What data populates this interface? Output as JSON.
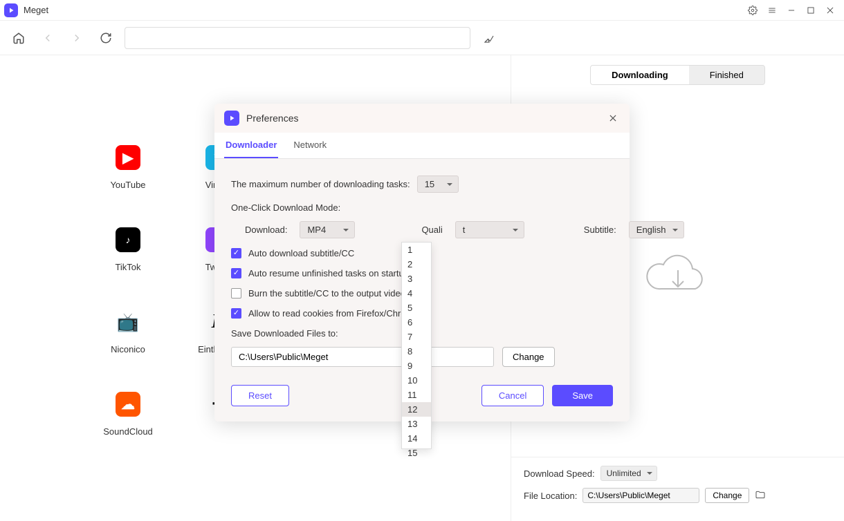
{
  "app": {
    "name": "Meget"
  },
  "toolbar": {
    "url_value": ""
  },
  "sites": [
    {
      "name": "YouTube"
    },
    {
      "name": "Vimeo"
    },
    {
      "name": "TikTok"
    },
    {
      "name": "Twitch"
    },
    {
      "name": "Niconico"
    },
    {
      "name": "Einthusan"
    },
    {
      "name": "SoundCloud"
    },
    {
      "name": ""
    }
  ],
  "right_panel": {
    "tabs": {
      "downloading": "Downloading",
      "finished": "Finished"
    },
    "speed_label": "Download Speed:",
    "speed_value": "Unlimited",
    "location_label": "File Location:",
    "location_value": "C:\\Users\\Public\\Meget",
    "change_label": "Change"
  },
  "prefs": {
    "title": "Preferences",
    "tabs": {
      "downloader": "Downloader",
      "network": "Network"
    },
    "max_tasks_label": "The maximum number of downloading tasks:",
    "max_tasks_value": "15",
    "max_tasks_options": [
      "1",
      "2",
      "3",
      "4",
      "5",
      "6",
      "7",
      "8",
      "9",
      "10",
      "11",
      "12",
      "13",
      "14",
      "15"
    ],
    "hover_option_index": 11,
    "mode_label": "One-Click Download Mode:",
    "download_label": "Download:",
    "download_value": "MP4",
    "quality_label": "Quali",
    "quality_value": "t",
    "subtitle_label": "Subtitle:",
    "subtitle_value": "English",
    "checks": [
      {
        "label": "Auto download subtitle/CC",
        "checked": true
      },
      {
        "label": "Auto resume unfinished tasks on startup",
        "checked": true
      },
      {
        "label": "Burn the subtitle/CC to the output video",
        "checked": false
      },
      {
        "label": "Allow to read cookies from Firefox/Chrome",
        "checked": true
      }
    ],
    "save_to_label": "Save Downloaded Files to:",
    "save_to_value": "C:\\Users\\Public\\Meget",
    "change_label": "Change",
    "reset_label": "Reset",
    "cancel_label": "Cancel",
    "save_label": "Save"
  }
}
